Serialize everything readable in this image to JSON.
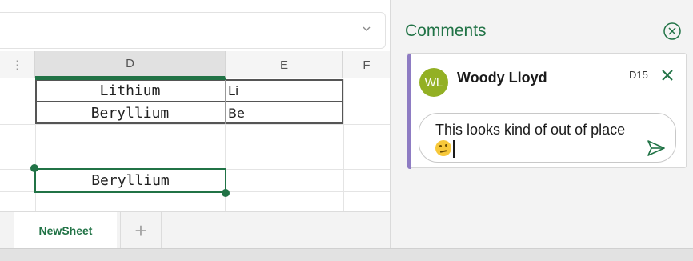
{
  "columns": {
    "D": "D",
    "E": "E",
    "F": "F"
  },
  "cells": {
    "row1": {
      "d": "Lithium",
      "e": "Li"
    },
    "row2": {
      "d": "Beryllium",
      "e": "Be"
    },
    "selected": {
      "d": "Beryllium"
    }
  },
  "sheet_tabs": {
    "active": "NewSheet",
    "add": "+"
  },
  "comments": {
    "title": "Comments",
    "thread": {
      "avatar_initials": "WL",
      "avatar_color": "#93b024",
      "author": "Woody Lloyd",
      "cell_ref": "D15",
      "reply_text": "This looks kind of out of place",
      "emoji": "thinking-face"
    }
  },
  "colors": {
    "accent": "#217346",
    "thread_accent": "#8e7cc3"
  },
  "icons": {
    "formula": "chevron-down-icon",
    "pane_close": "close-circle-icon",
    "thread_close": "close-icon",
    "send": "send-icon"
  }
}
